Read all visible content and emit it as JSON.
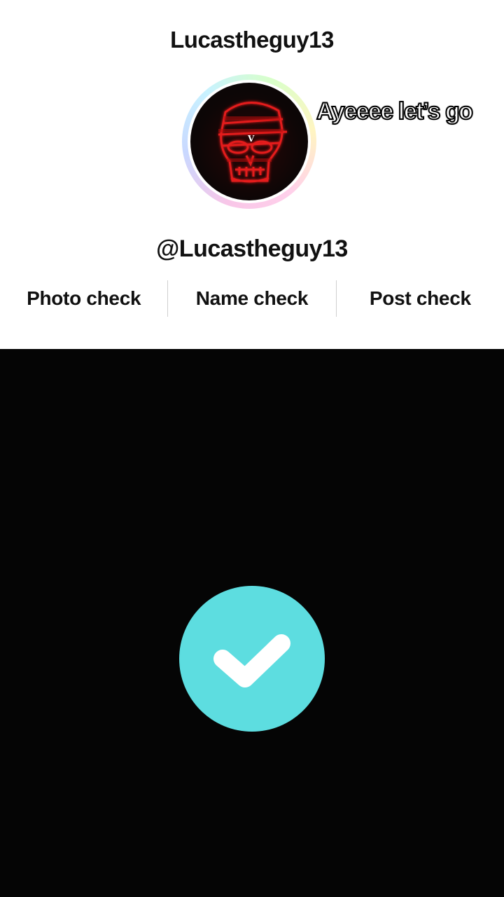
{
  "profile": {
    "title": "Lucastheguy13",
    "handle": "@Lucastheguy13",
    "caption": "Ayeeee let’s go"
  },
  "tabs": [
    {
      "label": "Photo check"
    },
    {
      "label": "Name check"
    },
    {
      "label": "Post check"
    }
  ],
  "status": {
    "icon": "checkmark-icon",
    "accent": "#5ddde0"
  },
  "colors": {
    "background_top": "#ffffff",
    "background_bottom": "#050505",
    "avatar_glow": "#e01818"
  }
}
